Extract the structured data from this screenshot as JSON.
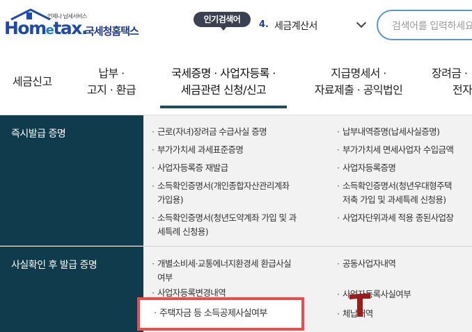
{
  "header": {
    "logo_tagline": "언제나 납세서비스",
    "logo_main_a": "Hom",
    "logo_main_e": "e",
    "logo_main_b": "tax.",
    "logo_kr": "국세청홈택스",
    "popular_badge": "인기검색어",
    "popular_num": "4.",
    "popular_term": "세금계산서",
    "search_placeholder": "검색어를 입력하세요"
  },
  "nav": {
    "items": [
      {
        "line1": "세금신고",
        "line2": ""
      },
      {
        "line1": "납부 ·",
        "line2": "고지 · 환급"
      },
      {
        "line1": "국세증명 · 사업자등록 ·",
        "line2": "세금관련 신청/신고"
      },
      {
        "line1": "지급명세서 ·",
        "line2": "자료제출 · 공익법인"
      },
      {
        "line1": "장려금 ·",
        "line2": "전자"
      }
    ],
    "active_index": 2
  },
  "sections": [
    {
      "title": "즉시발급 증명",
      "left_links": [
        "근로(자녀)장려금 수급사실 증명",
        "부가가치세 과세표준증명",
        "사업자등록증 재발급",
        "소득확인증명서(개인종합자산관리계좌",
        "가입용)",
        "소득확인증명서(청년도약계좌 가입 및 과",
        "세특례 신청용)"
      ],
      "right_links": [
        "납부내역증명(납세사실증명)",
        "부가가치세 면세사업자 수입금액",
        "사업자등록증명",
        "소득확인증명서(청년우대형주택",
        "저축 가입 및 과세특례 신청용)",
        "사업자단위과세 적용 종된사업장"
      ]
    },
    {
      "title": "사실확인 후 발급 증명",
      "left_links": [
        "개별소비세·교통에너지환경세 환급사실",
        "여부",
        "사업자등록변경내역",
        "주택자금 등 소득공제사실여부"
      ],
      "right_links": [
        "공동사업자내역",
        "사업자등록사실여부",
        "체납내역"
      ]
    }
  ],
  "colors": {
    "brand_blue": "#1f4aa8",
    "category_bg": "#0f3b4d",
    "highlight_border": "#ea4b4b",
    "search_border": "#5a96c8"
  }
}
